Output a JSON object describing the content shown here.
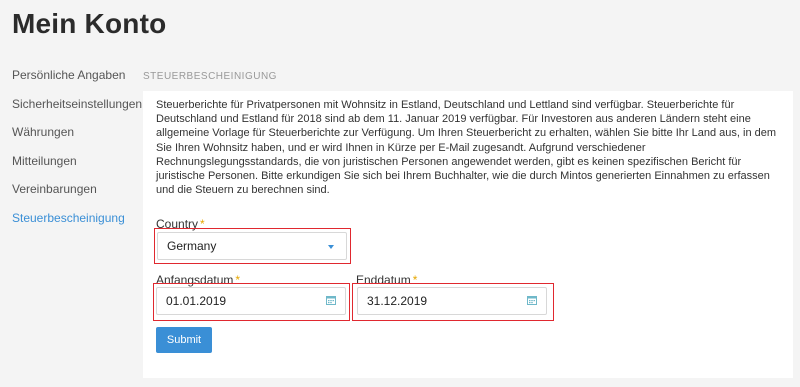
{
  "header": {
    "title": "Mein Konto"
  },
  "sidebar": {
    "items": [
      {
        "label": "Persönliche Angaben"
      },
      {
        "label": "Sicherheitseinstellungen"
      },
      {
        "label": "Währungen"
      },
      {
        "label": "Mitteilungen"
      },
      {
        "label": "Vereinbarungen"
      },
      {
        "label": "Steuerbescheinigung"
      }
    ],
    "active_index": 5
  },
  "main": {
    "section_label": "STEUERBESCHEINIGUNG",
    "info_text": "Steuerberichte für Privatpersonen mit Wohnsitz in Estland, Deutschland und Lettland sind verfügbar. Steuerberichte für Deutschland und Estland für 2018 sind ab dem 11. Januar 2019 verfügbar. Für Investoren aus anderen Ländern steht eine allgemeine Vorlage für Steuerberichte zur Verfügung. Um Ihren Steuerbericht zu erhalten, wählen Sie bitte Ihr Land aus, in dem Sie Ihren Wohnsitz haben, und er wird Ihnen in Kürze per E-Mail zugesandt. Aufgrund verschiedener Rechnungslegungsstandards, die von juristischen Personen angewendet werden, gibt es keinen spezifischen Bericht für juristische Personen. Bitte erkundigen Sie sich bei Ihrem Buchhalter, wie die durch Mintos generierten Einnahmen zu erfassen und die Steuern zu berechnen sind.",
    "country": {
      "label": "Country",
      "required": "*",
      "value": "Germany"
    },
    "start_date": {
      "label": "Anfangsdatum",
      "required": "*",
      "value": "01.01.2019"
    },
    "end_date": {
      "label": "Enddatum",
      "required": "*",
      "value": "31.12.2019"
    },
    "submit_label": "Submit"
  },
  "colors": {
    "accent": "#3a8fd6",
    "highlight": "#e0282f",
    "required": "#e6a700"
  },
  "icons": {
    "select": "chevron-down-icon",
    "date": "calendar-icon"
  }
}
